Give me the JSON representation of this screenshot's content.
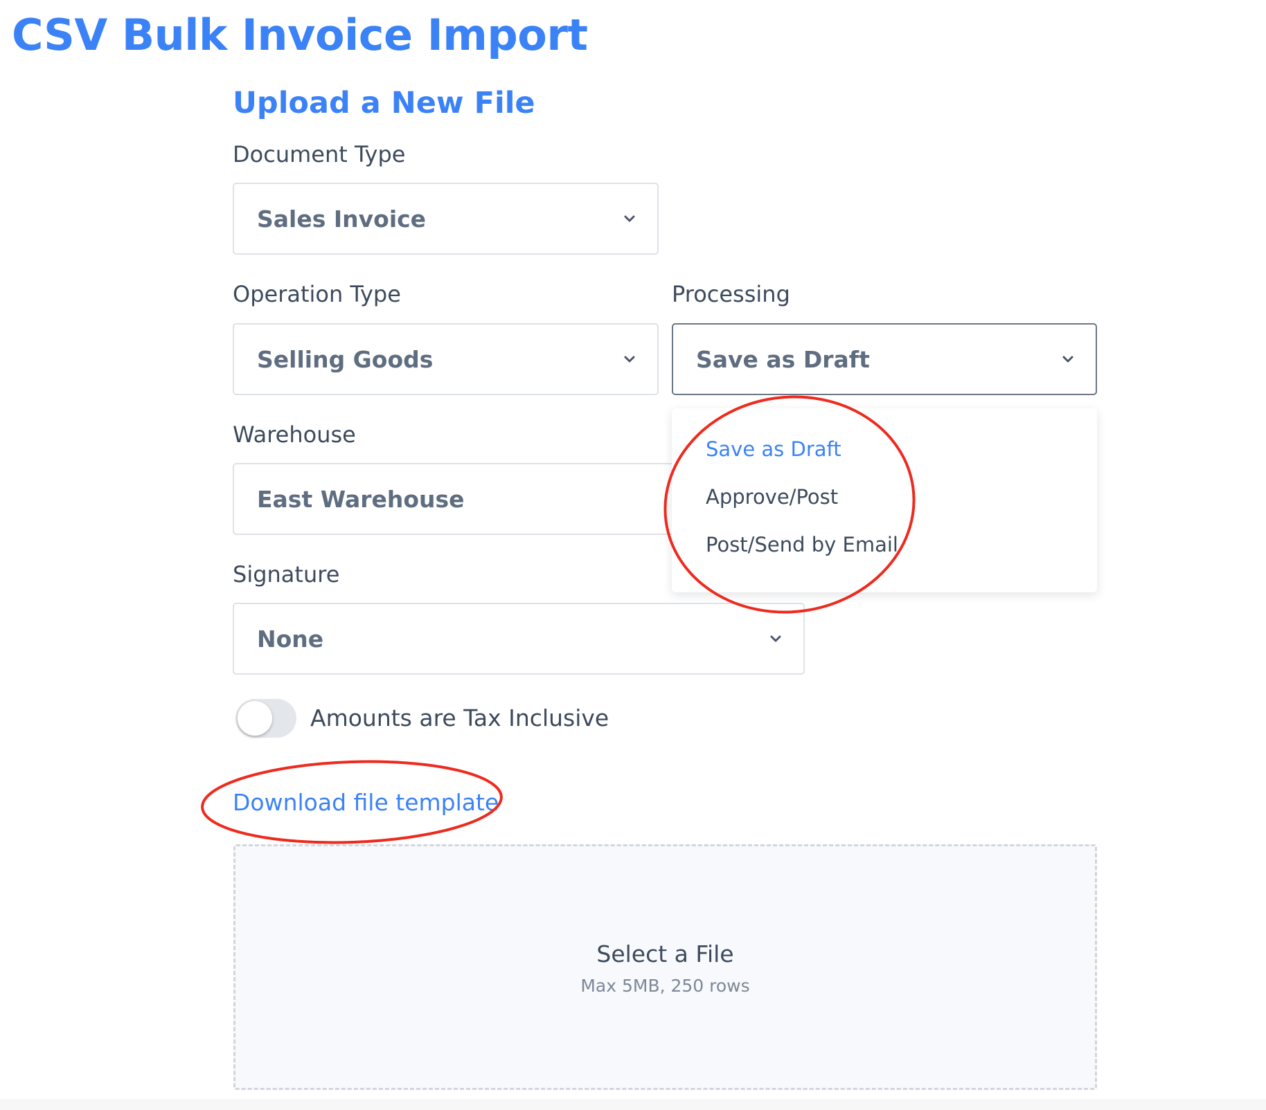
{
  "page": {
    "title": "CSV Bulk Invoice Import"
  },
  "form": {
    "section_title": "Upload a New File",
    "document_type": {
      "label": "Document Type",
      "value": "Sales Invoice",
      "icon": "chevron-down-icon"
    },
    "operation_type": {
      "label": "Operation Type",
      "value": "Selling Goods",
      "icon": "chevron-down-icon"
    },
    "processing": {
      "label": "Processing",
      "value": "Save as Draft",
      "icon": "chevron-down-icon",
      "open": true,
      "options": [
        "Save as Draft",
        "Approve/Post",
        "Post/Send by Email"
      ],
      "selected_index": 0
    },
    "warehouse": {
      "label": "Warehouse",
      "value": "East Warehouse"
    },
    "signature": {
      "label": "Signature",
      "value": "None",
      "icon": "chevron-down-icon"
    },
    "tax_inclusive": {
      "label": "Amounts are Tax Inclusive",
      "checked": false
    },
    "download_link": "Download file template",
    "dropzone": {
      "title": "Select a File",
      "subtitle": "Max 5MB, 250 rows"
    }
  },
  "colors": {
    "accent": "#3b82f6",
    "text": "#3d4a5c",
    "value_text": "#5f6d80",
    "border": "#dde2e8",
    "annotation_red": "#ee2a1e"
  }
}
